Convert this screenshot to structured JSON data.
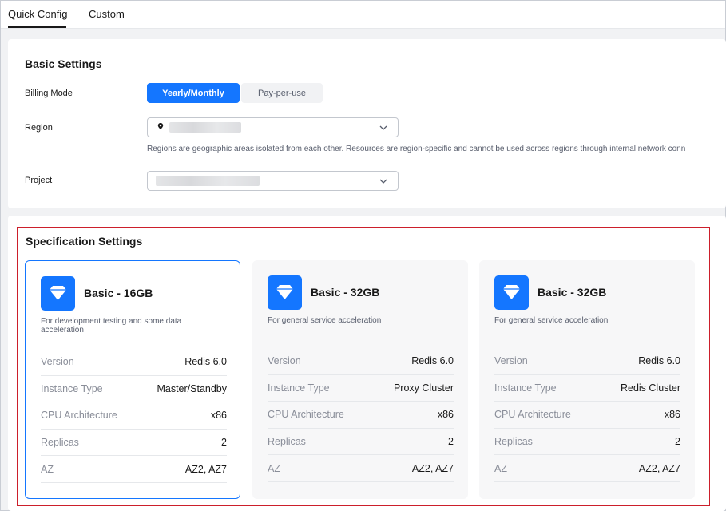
{
  "tabs": [
    {
      "label": "Quick Config",
      "active": true
    },
    {
      "label": "Custom",
      "active": false
    }
  ],
  "basic": {
    "title": "Basic Settings",
    "billing_label": "Billing Mode",
    "billing_options": [
      "Yearly/Monthly",
      "Pay-per-use"
    ],
    "billing_selected": "Yearly/Monthly",
    "region_label": "Region",
    "region_hint": "Regions are geographic areas isolated from each other. Resources are region-specific and cannot be used across regions through internal network conn",
    "project_label": "Project"
  },
  "spec": {
    "title": "Specification Settings",
    "cards": [
      {
        "title": "Basic - 16GB",
        "desc": "For development testing and some data acceleration",
        "selected": true,
        "rows": [
          {
            "k": "Version",
            "v": "Redis 6.0"
          },
          {
            "k": "Instance Type",
            "v": "Master/Standby"
          },
          {
            "k": "CPU Architecture",
            "v": "x86"
          },
          {
            "k": "Replicas",
            "v": "2"
          },
          {
            "k": "AZ",
            "v": "AZ2, AZ7"
          }
        ]
      },
      {
        "title": "Basic - 32GB",
        "desc": "For general service acceleration",
        "selected": false,
        "rows": [
          {
            "k": "Version",
            "v": "Redis 6.0"
          },
          {
            "k": "Instance Type",
            "v": "Proxy Cluster"
          },
          {
            "k": "CPU Architecture",
            "v": "x86"
          },
          {
            "k": "Replicas",
            "v": "2"
          },
          {
            "k": "AZ",
            "v": "AZ2, AZ7"
          }
        ]
      },
      {
        "title": "Basic - 32GB",
        "desc": "For general service acceleration",
        "selected": false,
        "rows": [
          {
            "k": "Version",
            "v": "Redis 6.0"
          },
          {
            "k": "Instance Type",
            "v": "Redis Cluster"
          },
          {
            "k": "CPU Architecture",
            "v": "x86"
          },
          {
            "k": "Replicas",
            "v": "2"
          },
          {
            "k": "AZ",
            "v": "AZ2, AZ7"
          }
        ]
      }
    ]
  },
  "icons": {
    "location": "location-pin-icon",
    "dropdown": "chevron-down-icon",
    "spec": "diamond-icon"
  },
  "colors": {
    "accent": "#1476ff",
    "highlight_border": "#cc1f2b"
  }
}
